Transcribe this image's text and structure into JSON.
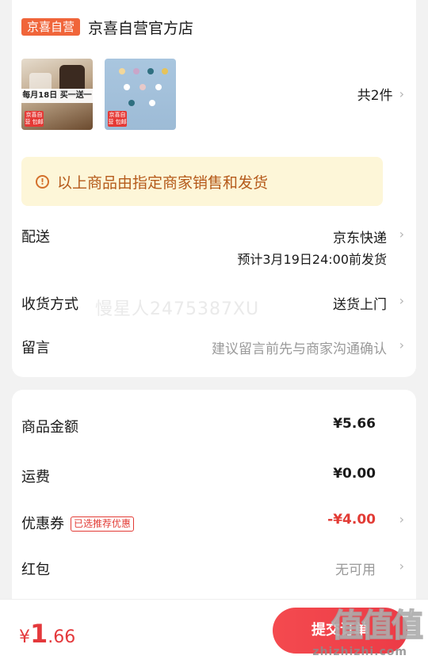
{
  "shop": {
    "badge": "京喜自营",
    "name": "京喜自营官方店"
  },
  "items": {
    "thumb1_banner": "每月18日 买一送一",
    "thumb_tag": "京喜自营 包邮",
    "count": "共2件"
  },
  "notice": {
    "text": "以上商品由指定商家销售和发货"
  },
  "delivery": {
    "label": "配送",
    "method": "京东快递",
    "estimate": "预计3月19日24:00前发货"
  },
  "receive": {
    "label": "收货方式",
    "value": "送货上门"
  },
  "message": {
    "label": "留言",
    "placeholder": "建议留言前先与商家沟通确认"
  },
  "watermark": "慢星人2475387XU",
  "summary": {
    "goods_label": "商品金额",
    "goods_value": "¥5.66",
    "shipping_label": "运费",
    "shipping_value": "¥0.00",
    "coupon_label": "优惠券",
    "coupon_tag": "已选推荐优惠",
    "coupon_value": "-¥4.00",
    "redpacket_label": "红包",
    "redpacket_value": "无可用"
  },
  "footer": {
    "price_symbol": "¥",
    "price_int": "1",
    "price_dec": ".66",
    "submit_label": "提交订单",
    "site_mark": "值值值",
    "site_url": "zhizhizhi.com"
  },
  "colors": {
    "accent_red": "#e4393c",
    "badge_orange": "#f0653a",
    "notice_bg": "#fdf6d8"
  }
}
